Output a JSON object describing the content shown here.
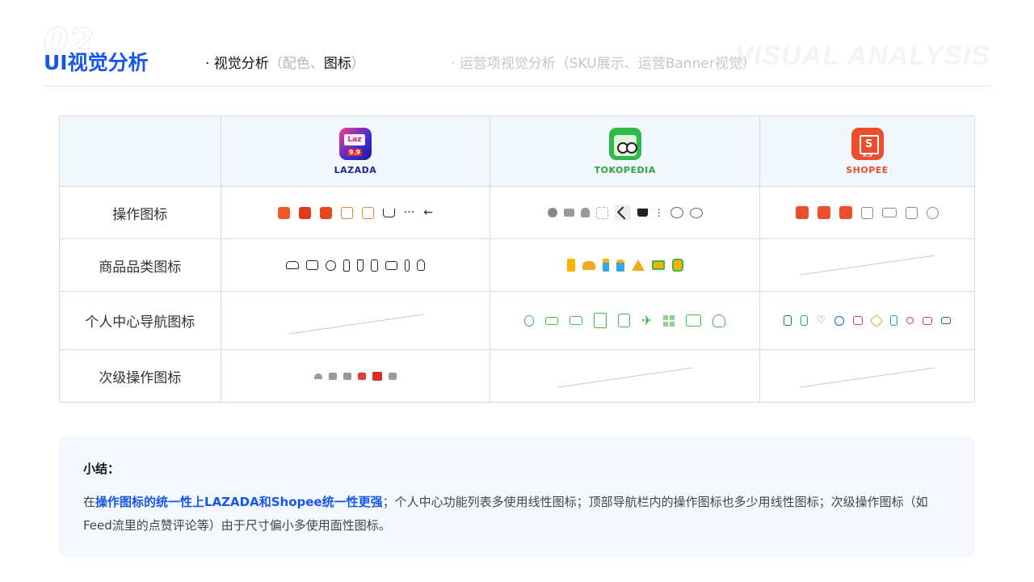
{
  "header": {
    "bg_number": "02",
    "bg_word": "VISUAL ANALYSIS",
    "title": "UI视觉分析",
    "nav_active": "· 视觉分析",
    "nav_active_paren": "（配色、",
    "nav_active_strong": "图标",
    "nav_active_close": "）",
    "nav_inactive": "· 运营项视觉分析（SKU展示、运营Banner视觉）"
  },
  "brands": [
    {
      "name": "LAZADA",
      "color": "#1a2a8f"
    },
    {
      "name": "TOKOPEDIA",
      "color": "#2fa43f"
    },
    {
      "name": "SHOPEE",
      "color": "#ee4d2d",
      "logo_text": "S"
    }
  ],
  "lazada_logo": {
    "badge": "Laz",
    "tag": "9.9"
  },
  "shopee_logo": {
    "tag": "9.9"
  },
  "rows": [
    {
      "label": "操作图标"
    },
    {
      "label": "商品品类图标"
    },
    {
      "label": "个人中心导航图标"
    },
    {
      "label": "次级操作图标"
    }
  ],
  "icons": {
    "lazada_action": [
      "camera-icon",
      "wallet-icon",
      "store-icon",
      "shop-icon",
      "chat-icon",
      "cart-icon",
      "more-icon",
      "back-arrow-icon"
    ],
    "lazada_action_glyphs": {
      "more": "···",
      "back": "←"
    },
    "lazada_category": [
      "sofa-icon",
      "tv-icon",
      "ball-icon",
      "bottle-icon",
      "plug-icon",
      "phone-icon",
      "computer-icon",
      "lipstick-icon",
      "baby-bottle-icon"
    ],
    "lazada_secondary": [
      "wifi-icon",
      "comment-icon",
      "like-icon",
      "share-icon",
      "qa-icon",
      "text-icon"
    ],
    "tokopedia_action": [
      "heart-filled-icon",
      "mail-icon",
      "bell-icon",
      "scan-icon",
      "share-icon",
      "cart-icon",
      "kebab-icon",
      "heart-outline-icon",
      "chat-outline-icon"
    ],
    "tokopedia_category": [
      "phone-icon",
      "sofa-icon",
      "cosmetic-icon",
      "baby-bottle-icon",
      "toy-icon",
      "monitor-icon",
      "train-icon"
    ],
    "tokopedia_profile": [
      "pin-icon",
      "card-icon",
      "ticket-icon",
      "bag-icon",
      "receipt-icon",
      "plane-icon",
      "grid-icon",
      "wallet-icon",
      "trophy-icon"
    ],
    "shopee_action": [
      "settings-icon",
      "cart-icon",
      "chat-icon",
      "wallet-icon",
      "truck-icon",
      "box-icon",
      "star-icon"
    ],
    "shopee_profile": [
      "clipboard-icon",
      "phone-icon",
      "heart-icon",
      "clock-icon",
      "wallet-icon",
      "tag-icon",
      "bookmark-icon",
      "coin-icon",
      "ticket-icon",
      "mail-icon"
    ]
  },
  "colors": {
    "accent": "#1656f0",
    "lazada_orange": "#f05a28",
    "shopee_red": "#ee4d2d",
    "tokopedia_green": "#42b549"
  },
  "summary": {
    "title": "小结：",
    "prefix": "在",
    "highlight": "操作图标的统一性上LAZADA和Shopee统一性更强",
    "rest": "；个人中心功能列表多使用线性图标；顶部导航栏内的操作图标也多少用线性图标；次级操作图标（如Feed流里的点赞评论等）由于尺寸偏小多使用面性图标。"
  }
}
